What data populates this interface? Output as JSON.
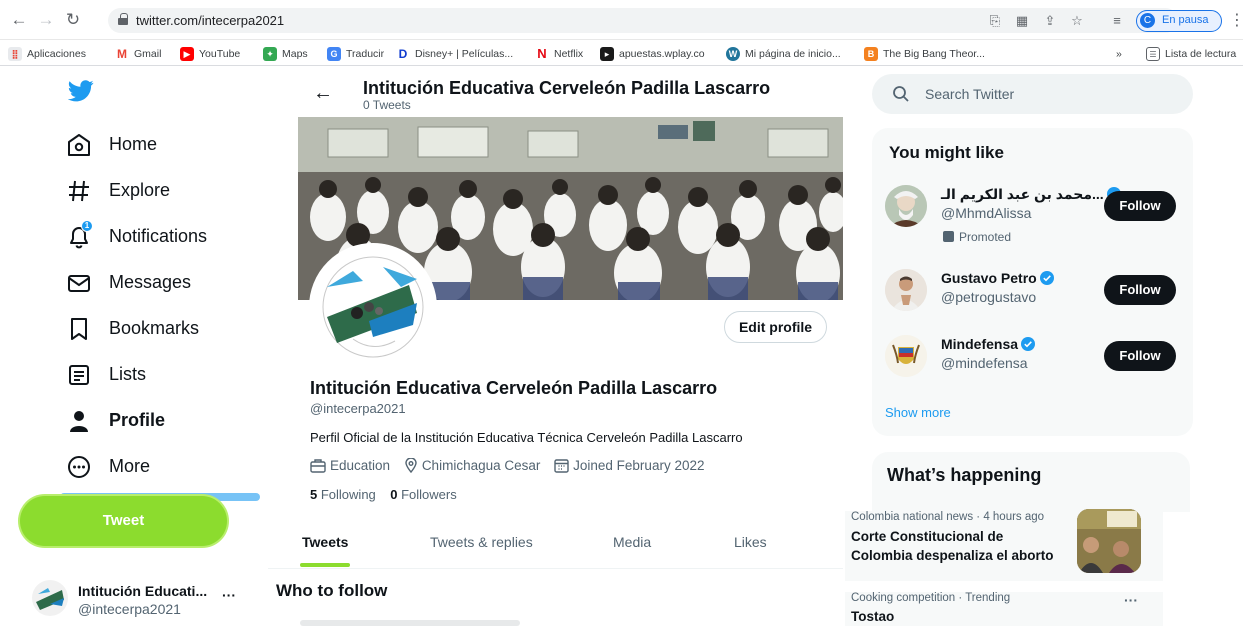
{
  "browser": {
    "url": "twitter.com/intecerpa2021",
    "profile_status": "En pausa",
    "profile_initial": "C",
    "bookmarks": [
      {
        "label": "Aplicaciones",
        "color": "#ea4335"
      },
      {
        "label": "Gmail",
        "color": "#ea4335"
      },
      {
        "label": "YouTube",
        "color": "#ff0000"
      },
      {
        "label": "Maps",
        "color": "#34a853"
      },
      {
        "label": "Traducir",
        "color": "#4285f4"
      },
      {
        "label": "Disney+ | Películas...",
        "color": "#113ccf"
      },
      {
        "label": "Netflix",
        "color": "#e50914"
      },
      {
        "label": "apuestas.wplay.co",
        "color": "#1a1a1a"
      },
      {
        "label": "Mi página de inicio...",
        "color": "#21759b"
      },
      {
        "label": "The Big Bang Theor...",
        "color": "#f4811f"
      }
    ],
    "overflow_label": "»",
    "reading_list": "Lista de lectura"
  },
  "nav": {
    "items": [
      {
        "label": "Home",
        "icon": "home-icon"
      },
      {
        "label": "Explore",
        "icon": "hashtag-icon"
      },
      {
        "label": "Notifications",
        "icon": "bell-icon",
        "badge": "1"
      },
      {
        "label": "Messages",
        "icon": "envelope-icon"
      },
      {
        "label": "Bookmarks",
        "icon": "bookmark-icon"
      },
      {
        "label": "Lists",
        "icon": "list-icon"
      },
      {
        "label": "Profile",
        "icon": "person-icon"
      },
      {
        "label": "More",
        "icon": "more-circle-icon"
      }
    ],
    "tweet_button": "Tweet",
    "account": {
      "name": "Intitución Educati...",
      "handle": "@intecerpa2021",
      "more": "···"
    }
  },
  "header": {
    "title": "Intitución Educativa Cerveleón Padilla Lascarro",
    "subtitle": "0 Tweets"
  },
  "profile": {
    "edit_button": "Edit profile",
    "name": "Intitución Educativa Cerveleón Padilla Lascarro",
    "handle": "@intecerpa2021",
    "bio": "Perfil Oficial de la Institución Educativa Técnica Cerveleón Padilla Lascarro",
    "category": "Education",
    "location": "Chimichagua Cesar",
    "joined": "Joined February 2022",
    "following_count": "5",
    "following_label": "Following",
    "followers_count": "0",
    "followers_label": "Followers"
  },
  "tabs": [
    "Tweets",
    "Tweets & replies",
    "Media",
    "Likes"
  ],
  "who_to_follow_title": "Who to follow",
  "search": {
    "placeholder": "Search Twitter"
  },
  "you_might_like": {
    "title": "You might like",
    "accounts": [
      {
        "name": "محمد بن عبد الكريم الـ...",
        "handle": "@MhmdAlissa",
        "promoted": "Promoted",
        "button": "Follow"
      },
      {
        "name": "Gustavo Petro",
        "handle": "@petrogustavo",
        "button": "Follow"
      },
      {
        "name": "Mindefensa",
        "handle": "@mindefensa",
        "button": "Follow"
      }
    ],
    "show_more": "Show more"
  },
  "whats_happening": {
    "title": "What’s happening",
    "trends": [
      {
        "meta": "Colombia national news · 4 hours ago",
        "title_line1": "Corte Constitucional de",
        "title_line2": "Colombia despenaliza el aborto"
      },
      {
        "meta": "Cooking competition · Trending",
        "title_line1": "Tostao",
        "more": "···"
      }
    ]
  },
  "colors": {
    "accent_green": "#8cdc2e",
    "twitter_blue": "#1d9bf0",
    "text": "#0f1419",
    "muted": "#536471"
  }
}
